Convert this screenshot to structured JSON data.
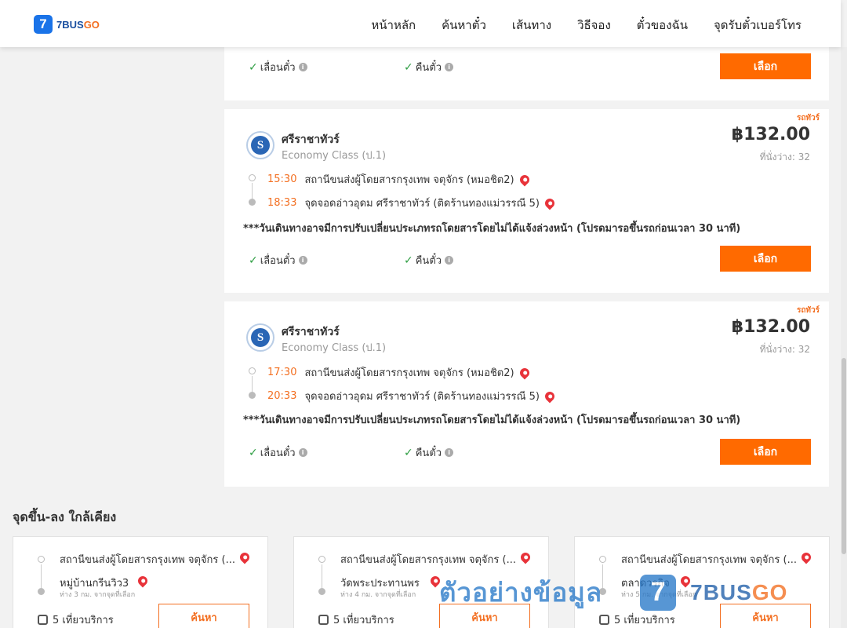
{
  "header": {
    "logo_badge": "7",
    "logo_text_1": "7BUS",
    "logo_text_2": "GO",
    "nav": [
      "หน้าหลัก",
      "ค้นหาตั๋ว",
      "เส้นทาง",
      "วิธีจอง",
      "ตั๋วของฉัน",
      "จุดรับตั๋วเบอร์โทร"
    ]
  },
  "common": {
    "reschedule": "เลื่อนตั๋ว",
    "refund": "คืนตั๋ว",
    "select": "เลือก",
    "info_glyph": "i",
    "check_glyph": "✓"
  },
  "trips": [
    {
      "tag": "รถทัวร์",
      "operator": "ศรีราชาทัวร์",
      "class": "Economy Class (ป.1)",
      "price": "฿132.00",
      "seats": "ที่นั่งว่าง: 32",
      "depart_time": "15:30",
      "depart_station": "สถานีขนส่งผู้โดยสารกรุงเทพ จตุจักร (หมอชิต2)",
      "arrive_time": "18:33",
      "arrive_station": "จุดจอดอ่าวอุดม ศรีราชาทัวร์ (ติดร้านทองแม่วรรณี 5)",
      "notice": "***วันเดินทางอาจมีการปรับเปลี่ยนประเภทรถโดยสารโดยไม่ได้แจ้งล่วงหน้า (โปรดมารอขึ้นรถก่อนเวลา 30 นาที)"
    },
    {
      "tag": "รถทัวร์",
      "operator": "ศรีราชาทัวร์",
      "class": "Economy Class (ป.1)",
      "price": "฿132.00",
      "seats": "ที่นั่งว่าง: 32",
      "depart_time": "17:30",
      "depart_station": "สถานีขนส่งผู้โดยสารกรุงเทพ จตุจักร (หมอชิต2)",
      "arrive_time": "20:33",
      "arrive_station": "จุดจอดอ่าวอุดม ศรีราชาทัวร์ (ติดร้านทองแม่วรรณี 5)",
      "notice": "***วันเดินทางอาจมีการปรับเปลี่ยนประเภทรถโดยสารโดยไม่ได้แจ้งล่วงหน้า (โปรดมารอขึ้นรถก่อนเวลา 30 นาที)"
    }
  ],
  "nearby": {
    "title": "จุดขึ้น-ลง ใกล้เคียง",
    "search": "ค้นหา",
    "items": [
      {
        "origin": "สถานีขนส่งผู้โดยสารกรุงเทพ จตุจักร (...",
        "dest": "หมู่บ้านกรีนวิว3",
        "distance": "ห่าง 3 กม. จากจุดที่เลือก",
        "trips": "5 เที่ยวบริการ"
      },
      {
        "origin": "สถานีขนส่งผู้โดยสารกรุงเทพ จตุจักร (...",
        "dest": "วัดพระประทานพร",
        "distance": "ห่าง 4 กม. จากจุดที่เลือก",
        "trips": "5 เที่ยวบริการ"
      },
      {
        "origin": "สถานีขนส่งผู้โดยสารกรุงเทพ จตุจักร (...",
        "dest": "ตลาดวรกิจ",
        "distance": "ห่าง 5 กม. จากจุดที่เลือก",
        "trips": "5 เที่ยวบริการ"
      }
    ]
  },
  "watermark": {
    "text": "ตัวอย่างข้อมูล",
    "badge": "7",
    "brand_1": "7BUS",
    "brand_2": "GO"
  },
  "colors": {
    "accent": "#ff6a00",
    "brand_blue": "#1a73e8",
    "time_orange": "#f36f21",
    "check_green": "#2e9e43",
    "pin_red": "#e8333a"
  }
}
